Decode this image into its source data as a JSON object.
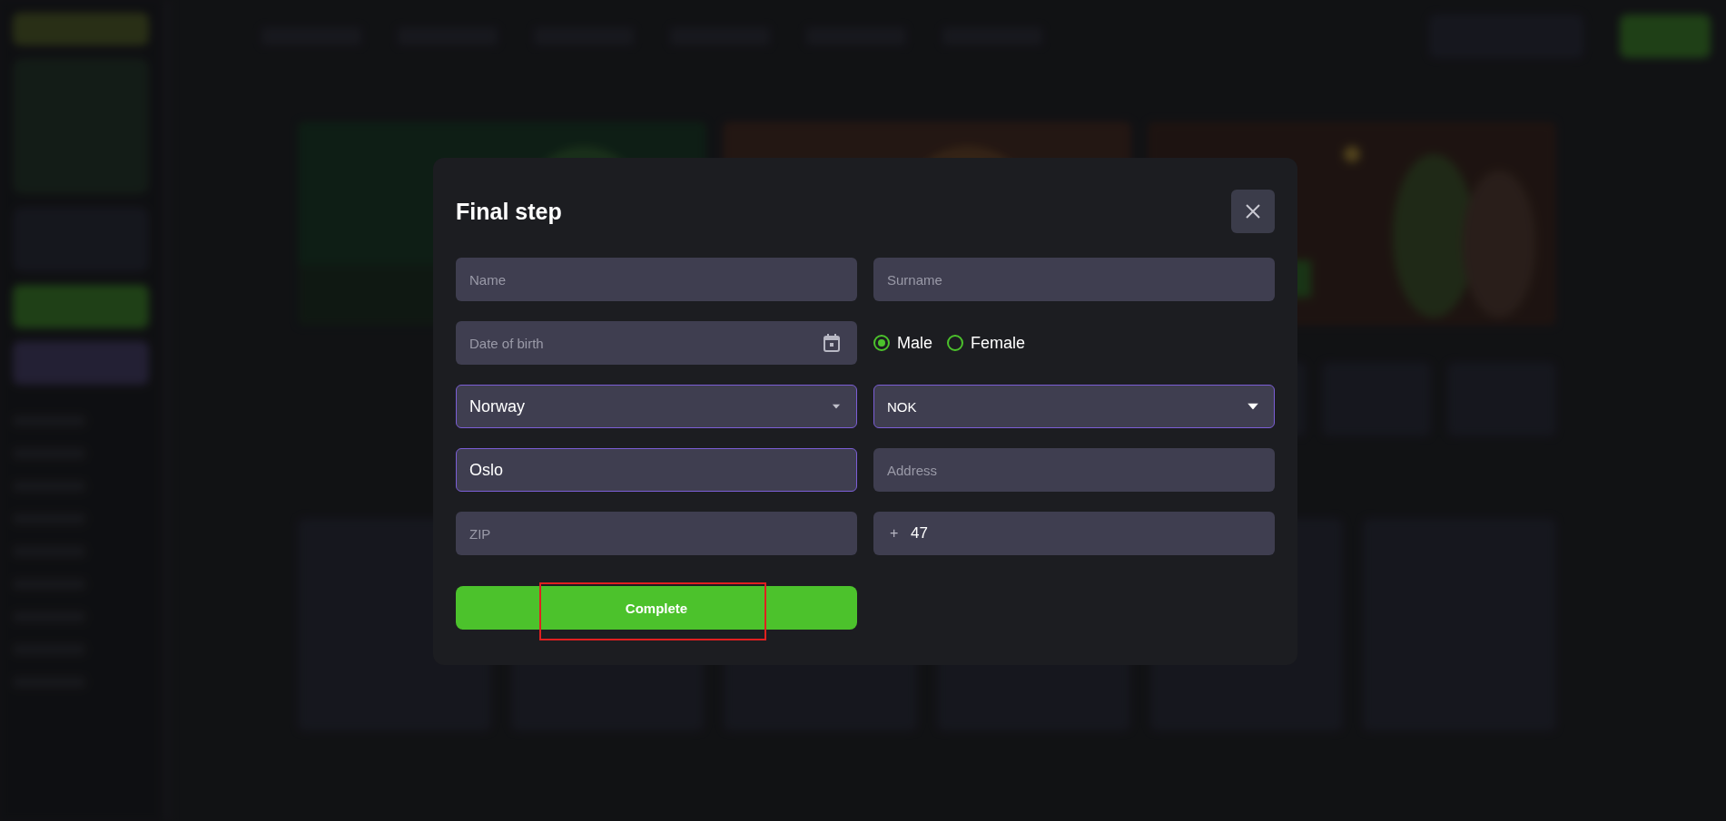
{
  "dialog": {
    "title": "Final step",
    "fields": [
      {
        "kind": "text",
        "placeholder": "Name",
        "active": false
      },
      {
        "kind": "text",
        "placeholder": "Surname",
        "active": false
      },
      {
        "kind": "date",
        "placeholder": "Date of birth",
        "active": false
      },
      {
        "kind": "radio",
        "options": [
          {
            "label": "Male",
            "selected": true
          },
          {
            "label": "Female",
            "selected": false
          }
        ]
      },
      {
        "kind": "select",
        "value": "Norway",
        "active": true
      },
      {
        "kind": "select",
        "value": "NOK",
        "active": true
      },
      {
        "kind": "text",
        "value": "Oslo",
        "active": true
      },
      {
        "kind": "text",
        "placeholder": "Address",
        "active": false
      },
      {
        "kind": "text",
        "placeholder": "ZIP",
        "active": false
      },
      {
        "kind": "phone",
        "prefix": "+",
        "value": "47",
        "active": false
      }
    ],
    "submit": {
      "label": "Complete",
      "highlighted": true
    }
  }
}
